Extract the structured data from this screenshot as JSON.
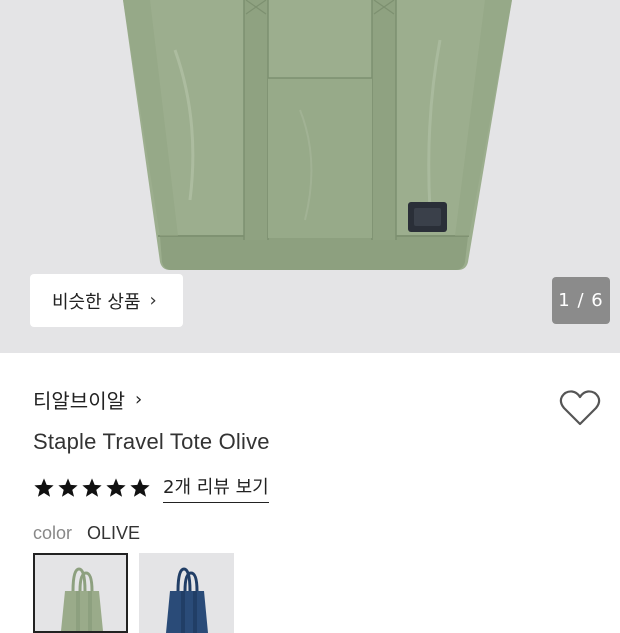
{
  "gallery": {
    "similar_label": "비슷한 상품",
    "similar_chevron": "›",
    "counter": "1 / 6"
  },
  "product": {
    "brand": "티알브이알",
    "brand_chevron": "›",
    "title": "Staple Travel Tote Olive",
    "rating": 5,
    "review_link": "2개 리뷰 보기",
    "color_label": "color",
    "color_value": "OLIVE",
    "swatches": [
      {
        "name": "OLIVE",
        "color": "#9aab8a"
      },
      {
        "name": "NAVY",
        "color": "#2a4b78"
      }
    ]
  },
  "icons": {
    "wishlist": "heart-icon",
    "star": "star-icon",
    "chevron": "chevron-right-icon"
  },
  "colors": {
    "bag": "#9cae8e",
    "bag_dark": "#889b7b",
    "background": "#e4e4e6",
    "counter_bg": "#8b8b8b"
  }
}
